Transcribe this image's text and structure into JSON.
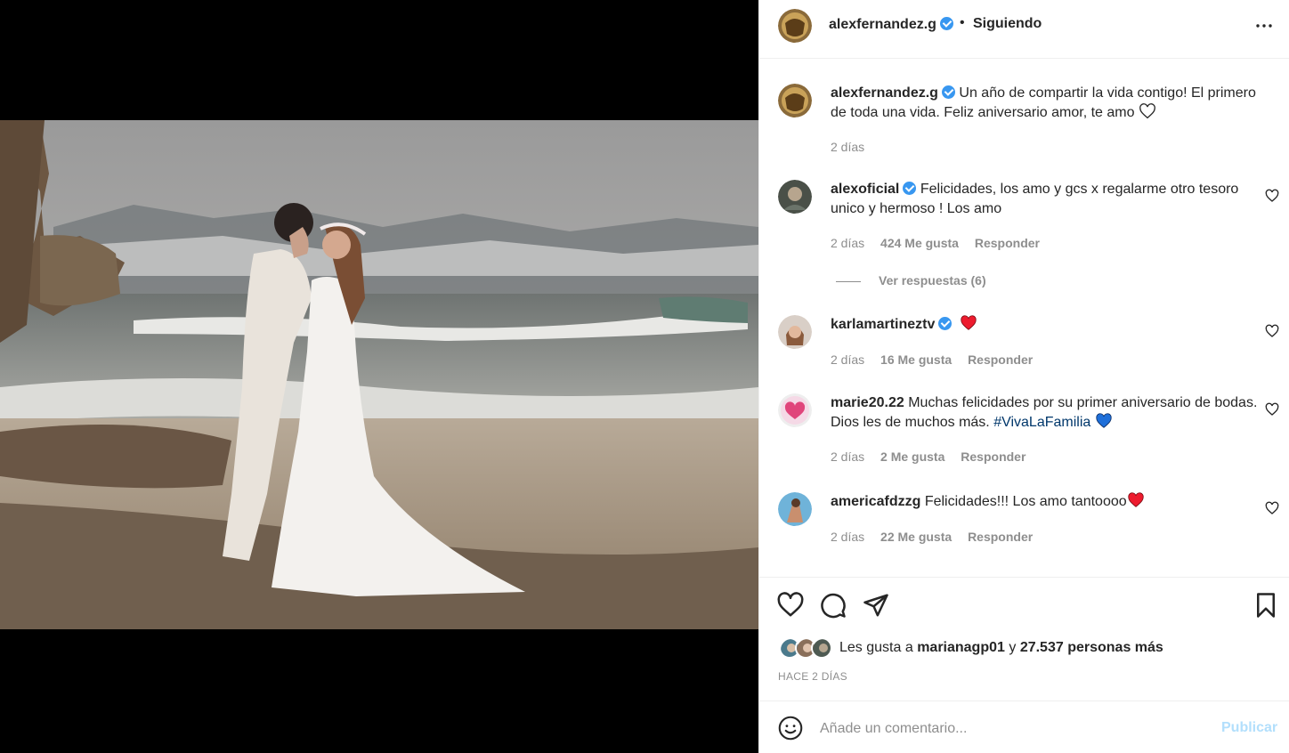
{
  "post": {
    "author": "alexfernandez.g",
    "separator": "•",
    "follow_status": "Siguiendo",
    "caption": "Un año de compartir la vida contigo! El primero de toda una vida. Feliz aniversario amor, te amo",
    "caption_time": "2 días"
  },
  "comments": [
    {
      "user": "alexoficial",
      "verified": true,
      "text": "Felicidades, los amo y gcs x regalarme otro tesoro unico y hermoso ! Los amo",
      "time": "2 días",
      "likes": "424 Me gusta",
      "reply": "Responder",
      "view_replies": "Ver respuestas (6)"
    },
    {
      "user": "karlamartineztv",
      "verified": true,
      "text": "",
      "time": "2 días",
      "likes": "16 Me gusta",
      "reply": "Responder"
    },
    {
      "user": "marie20.22",
      "verified": false,
      "text": "Muchas felicidades por su primer aniversario de bodas. Dios les de muchos más. ",
      "hashtag": "#VivaLaFamilia",
      "time": "2 días",
      "likes": "2 Me gusta",
      "reply": "Responder"
    },
    {
      "user": "americafdzzg",
      "verified": false,
      "text": "Felicidades!!! Los amo tantoooo",
      "time": "2 días",
      "likes": "22 Me gusta",
      "reply": "Responder"
    }
  ],
  "likes": {
    "prefix": "Les gusta a",
    "user": "marianagp01",
    "conj": "y",
    "others": "27.537 personas más"
  },
  "posted_ago": "HACE 2 DÍAS",
  "add_comment": {
    "placeholder": "Añade un comentario...",
    "post_label": "Publicar"
  },
  "icons": {
    "header_more": "more-horizontal-icon",
    "like": "heart-icon",
    "comment": "comment-icon",
    "share": "paper-plane-icon",
    "save": "bookmark-icon",
    "emoji": "smiley-icon"
  },
  "colors": {
    "verified": "#3897f0",
    "link": "#00376b",
    "publish_disabled": "#b2dffc",
    "heart_red": "#ed1b2e",
    "heart_blue": "#1e6fd9"
  }
}
